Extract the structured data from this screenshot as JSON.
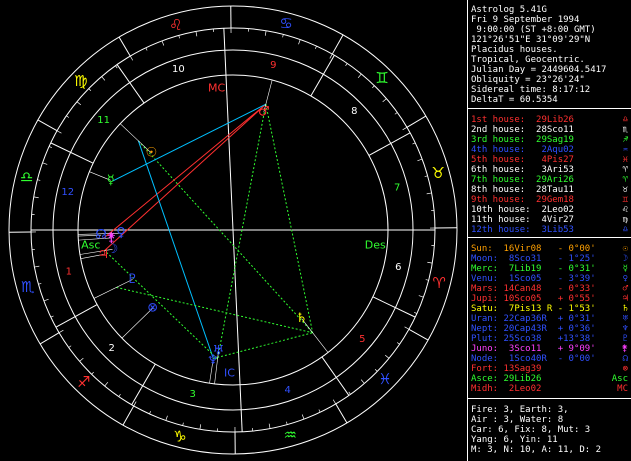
{
  "header": [
    "Astrolog 5.41G",
    "Fri 9 September 1994",
    " 9:00:00 (ST +8:00 GMT)",
    "121°26'51\"E 31°09'29\"N",
    "Placidus houses.",
    "Tropical, Geocentric.",
    "Julian Day = 2449604.5417",
    "Obliquity = 23°26'24\"",
    "Sidereal time: 8:17:12",
    "DeltaT = 60.5354"
  ],
  "houses": [
    {
      "label": "1st house:",
      "value": "29Lib26",
      "color": "#ff3030",
      "glyph": "♎"
    },
    {
      "label": "2nd house:",
      "value": "28Sco11",
      "color": "#ffffff",
      "glyph": "♏"
    },
    {
      "label": "3rd house:",
      "value": "29Sag19",
      "color": "#30ff30",
      "glyph": "♐"
    },
    {
      "label": "4th house:",
      "value": " 2Aqu02",
      "color": "#3050ff",
      "glyph": "♒"
    },
    {
      "label": "5th house:",
      "value": " 4Pis27",
      "color": "#ff3030",
      "glyph": "♓"
    },
    {
      "label": "6th house:",
      "value": " 3Ari53",
      "color": "#ffffff",
      "glyph": "♈"
    },
    {
      "label": "7th house:",
      "value": "29Ari26",
      "color": "#30ff30",
      "glyph": "♈"
    },
    {
      "label": "8th house:",
      "value": "28Tau11",
      "color": "#ffffff",
      "glyph": "♉"
    },
    {
      "label": "9th house:",
      "value": "29Gem18",
      "color": "#ff3030",
      "glyph": "♊"
    },
    {
      "label": "10th house:",
      "value": " 2Leo02",
      "color": "#ffffff",
      "glyph": "♌"
    },
    {
      "label": "11th house:",
      "value": " 4Vir27",
      "color": "#ffffff",
      "glyph": "♍"
    },
    {
      "label": "12th house:",
      "value": " 3Lib53",
      "color": "#3050ff",
      "glyph": "♎"
    }
  ],
  "planets": [
    {
      "name": "Sun:",
      "pos": "16Vir08",
      "speed": " - 0°00'",
      "color": "#ffa000",
      "glyph": "☉"
    },
    {
      "name": "Moon:",
      "pos": " 8Sco31",
      "speed": " - 1°25'",
      "color": "#3050ff",
      "glyph": "☽"
    },
    {
      "name": "Merc:",
      "pos": " 7Lib19",
      "speed": " - 0°31'",
      "color": "#30ff30",
      "glyph": "☿"
    },
    {
      "name": "Venu:",
      "pos": " 1Sco05",
      "speed": " - 3°39'",
      "color": "#3050ff",
      "glyph": "♀"
    },
    {
      "name": "Mars:",
      "pos": "14Can48",
      "speed": " - 0°33'",
      "color": "#ff3030",
      "glyph": "♂"
    },
    {
      "name": "Jupi:",
      "pos": "10Sco05",
      "speed": " + 0°55'",
      "color": "#ff3030",
      "glyph": "♃"
    },
    {
      "name": "Satu:",
      "pos": " 7Pis13 R",
      "speed": " - 1°53'",
      "color": "#ffff00",
      "glyph": "♄"
    },
    {
      "name": "Uran:",
      "pos": "22Cap36R",
      "speed": " + 0°31'",
      "color": "#3050ff",
      "glyph": "♅"
    },
    {
      "name": "Nept:",
      "pos": "20Cap43R",
      "speed": " + 0°36'",
      "color": "#3050ff",
      "glyph": "♆"
    },
    {
      "name": "Plut:",
      "pos": "25Sco38",
      "speed": " +13°38'",
      "color": "#3050ff",
      "glyph": "♇"
    },
    {
      "name": "Juno:",
      "pos": " 3Sco11",
      "speed": " + 9°09'",
      "color": "#ff40ff",
      "glyph": "⚵"
    },
    {
      "name": "Node:",
      "pos": " 1Sco40R",
      "speed": " - 0°00'",
      "color": "#3050ff",
      "glyph": "☊"
    },
    {
      "name": "Fort:",
      "pos": "13Sag39",
      "speed": "",
      "color": "#ff3030",
      "glyph": "⊗"
    },
    {
      "name": "Asce:",
      "pos": "29Lib26",
      "speed": "",
      "color": "#30ff30",
      "glyph": "Asc"
    },
    {
      "name": "Midh:",
      "pos": " 2Leo02",
      "speed": "",
      "color": "#ff3030",
      "glyph": "MC"
    }
  ],
  "elements": [
    "Fire: 3, Earth: 3,",
    "Air : 3, Water: 8",
    "Car: 6, Fix: 8, Mut: 3",
    "Yang: 6, Yin: 11",
    "M: 3, N: 10, A: 11, D: 2"
  ],
  "wheel": {
    "signs": [
      {
        "glyph": "♈",
        "color": "#ff3030"
      },
      {
        "glyph": "♉",
        "color": "#ffff00"
      },
      {
        "glyph": "♊",
        "color": "#30ff30"
      },
      {
        "glyph": "♋",
        "color": "#3050ff"
      },
      {
        "glyph": "♌",
        "color": "#ff3030"
      },
      {
        "glyph": "♍",
        "color": "#ffff00"
      },
      {
        "glyph": "♎",
        "color": "#30ff30"
      },
      {
        "glyph": "♏",
        "color": "#3050ff"
      },
      {
        "glyph": "♐",
        "color": "#ff3030"
      },
      {
        "glyph": "♑",
        "color": "#ffff00"
      },
      {
        "glyph": "♒",
        "color": "#30ff30"
      },
      {
        "glyph": "♓",
        "color": "#3050ff"
      }
    ],
    "house_numbers": [
      {
        "n": "1",
        "color": "#ff3030"
      },
      {
        "n": "2",
        "color": "#ffffff"
      },
      {
        "n": "3",
        "color": "#30ff30"
      },
      {
        "n": "4",
        "color": "#3050ff"
      },
      {
        "n": "5",
        "color": "#ff3030"
      },
      {
        "n": "6",
        "color": "#ffffff"
      },
      {
        "n": "7",
        "color": "#30ff30"
      },
      {
        "n": "8",
        "color": "#ffffff"
      },
      {
        "n": "9",
        "color": "#ff3030"
      },
      {
        "n": "10",
        "color": "#ffffff"
      },
      {
        "n": "11",
        "color": "#30ff30"
      },
      {
        "n": "12",
        "color": "#3050ff"
      }
    ],
    "asc_label": "Asc",
    "des_label": "Des",
    "mc_label": "MC",
    "ic_label": "IC"
  }
}
